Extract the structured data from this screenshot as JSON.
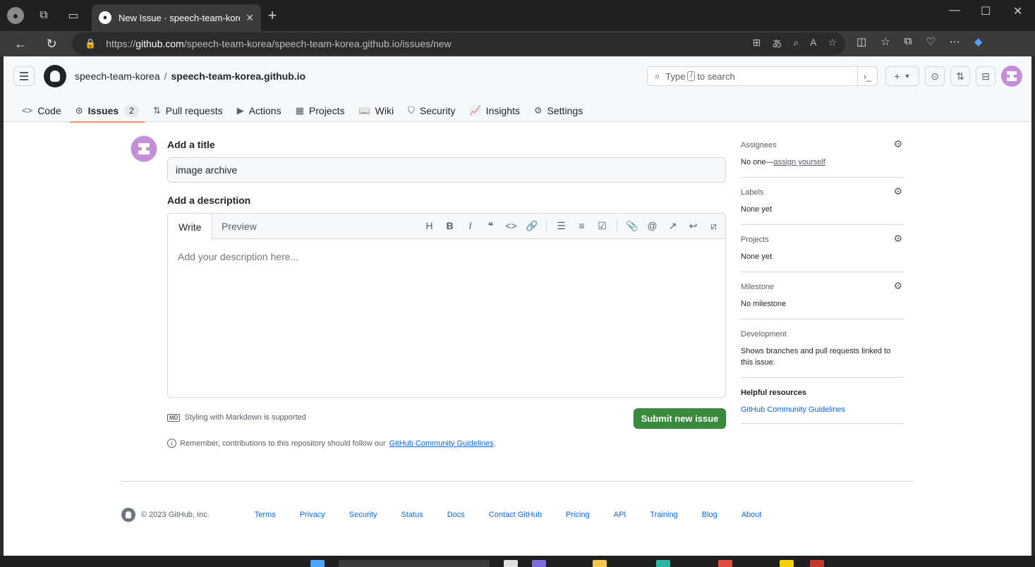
{
  "browser": {
    "tab_title": "New Issue · speech-team-korea/s",
    "url_host": "github.com",
    "url_prefix": "https://",
    "url_path": "/speech-team-korea/speech-team-korea.github.io/issues/new"
  },
  "header": {
    "owner": "speech-team-korea",
    "separator": "/",
    "repo": "speech-team-korea.github.io",
    "search_prefix": "Type",
    "search_key": "/",
    "search_suffix": "to search"
  },
  "repo_nav": {
    "code": "Code",
    "issues": "Issues",
    "issues_count": "2",
    "pulls": "Pull requests",
    "actions": "Actions",
    "projects": "Projects",
    "wiki": "Wiki",
    "security": "Security",
    "insights": "Insights",
    "settings": "Settings"
  },
  "form": {
    "title_label": "Add a title",
    "title_value": "image archive",
    "desc_label": "Add a description",
    "write_tab": "Write",
    "preview_tab": "Preview",
    "desc_placeholder": "Add your description here...",
    "markdown_badge": "MD",
    "markdown_note": "Styling with Markdown is supported",
    "submit_label": "Submit new issue",
    "remember_text": "Remember, contributions to this repository should follow our",
    "remember_link": "GitHub Community Guidelines",
    "remember_end": "."
  },
  "sidebar": {
    "assignees_title": "Assignees",
    "assignees_value": "No one—",
    "assign_yourself": "assign yourself",
    "labels_title": "Labels",
    "labels_value": "None yet",
    "projects_title": "Projects",
    "projects_value": "None yet",
    "milestone_title": "Milestone",
    "milestone_value": "No milestone",
    "development_title": "Development",
    "development_value": "Shows branches and pull requests linked to this issue.",
    "helpful_title": "Helpful resources",
    "helpful_link": "GitHub Community Guidelines"
  },
  "footer": {
    "copyright": "© 2023 GitHub, Inc.",
    "links": [
      "Terms",
      "Privacy",
      "Security",
      "Status",
      "Docs",
      "Contact GitHub",
      "Pricing",
      "API",
      "Training",
      "Blog",
      "About"
    ]
  },
  "colors": {
    "submit_green": "#3a8a3e",
    "link_blue": "#0969da",
    "active_underline": "#fd8c73"
  }
}
